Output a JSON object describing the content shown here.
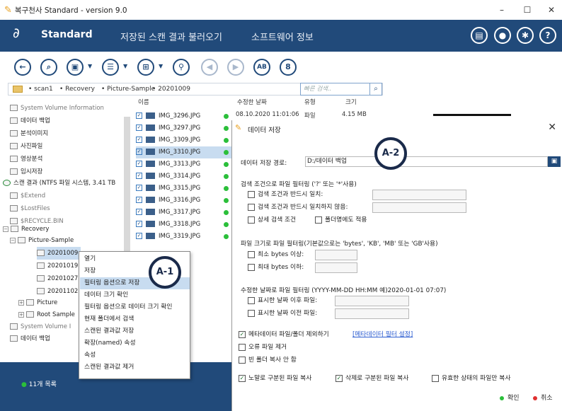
{
  "window": {
    "title": "복구천사 Standard - version 9.0",
    "controls": {
      "minimize": "–",
      "maximize": "☐",
      "close": "✕"
    }
  },
  "header": {
    "brand_name": "Standard",
    "nav": [
      "저장된 스캔 결과 불러오기",
      "소프트웨어 정보"
    ],
    "icons": [
      "card-icon",
      "user-icon",
      "gear-icon",
      "help-icon"
    ],
    "help_glyph": "?",
    "bg_color": "#214a7a"
  },
  "toolbar": {
    "buttons": [
      {
        "name": "back-icon",
        "glyph": "←",
        "disabled": false
      },
      {
        "name": "search-icon",
        "glyph": "⌕",
        "disabled": false
      },
      {
        "name": "save-icon",
        "glyph": "▣",
        "disabled": false
      },
      {
        "name": "list-view-icon",
        "glyph": "☰",
        "disabled": false
      },
      {
        "name": "grid-view-icon",
        "glyph": "⊞",
        "disabled": false
      },
      {
        "name": "binoculars-icon",
        "glyph": "⚲",
        "disabled": false
      },
      {
        "name": "prev-icon",
        "glyph": "◀",
        "disabled": true
      },
      {
        "name": "next-icon",
        "glyph": "▶",
        "disabled": true
      },
      {
        "name": "ab-compare-icon",
        "glyph": "AB",
        "disabled": false
      },
      {
        "name": "lifebuoy-icon",
        "glyph": "8",
        "disabled": false
      }
    ]
  },
  "breadcrumb": {
    "items": [
      "scan1",
      "Recovery",
      "Picture-Sample",
      "20201009"
    ],
    "search_placeholder": "빠른 검색..",
    "search_icon": "search-icon"
  },
  "tree": {
    "items": [
      {
        "label": "System Volume Information",
        "gray": true
      },
      {
        "label": "데이터 백업",
        "gray": false
      },
      {
        "label": "분석이미지",
        "gray": false
      },
      {
        "label": "사진파일",
        "gray": false
      },
      {
        "label": "영상분석",
        "gray": false
      },
      {
        "label": "임시저장",
        "gray": false
      },
      {
        "label": "스캔 결과 (NTFS 파일 시스템, 3.41 TB",
        "gray": false
      },
      {
        "label": "$Extend",
        "gray": true
      },
      {
        "label": "$LostFiles",
        "gray": true
      },
      {
        "label": "$RECYCLE.BIN",
        "gray": true
      },
      {
        "label": "Recovery",
        "gray": false
      },
      {
        "label": "Picture-Sample",
        "gray": false
      },
      {
        "label": "20201009",
        "gray": false
      },
      {
        "label": "20201019",
        "gray": false
      },
      {
        "label": "20201027",
        "gray": false
      },
      {
        "label": "20201102",
        "gray": false
      },
      {
        "label": "Picture",
        "gray": false
      },
      {
        "label": "Root Sample",
        "gray": false
      },
      {
        "label": "System Volume I",
        "gray": true
      },
      {
        "label": "데이터 백업",
        "gray": false
      }
    ],
    "expand_glyphs": {
      "collapsed": "+",
      "expanded": "−"
    }
  },
  "filelist": {
    "headers": {
      "name": "이름",
      "modified": "수정한 날짜",
      "type": "유형",
      "size": "크기"
    },
    "first_row": {
      "modified": "08.10.2020 11:01:06",
      "type": "파일",
      "size": "4.15 MB"
    },
    "check_glyph": "✓",
    "files": [
      "IMG_3296.JPG",
      "IMG_3297.JPG",
      "IMG_3309.JPG",
      "IMG_3310.JPG",
      "IMG_3313.JPG",
      "IMG_3314.JPG",
      "IMG_3315.JPG",
      "IMG_3316.JPG",
      "IMG_3317.JPG",
      "IMG_3318.JPG",
      "IMG_3319.JPG"
    ]
  },
  "context_menu": {
    "items": [
      "열기",
      "저장",
      "필터링 옵션으로 저장",
      "데이터 크기 확인",
      "필터링 옵션으로 데이터 크기 확인",
      "현재 폴더에서 검색",
      "스캔된 결과값 저장",
      "확장(named) 속성",
      "속성",
      "스캔된 결과값 제거"
    ],
    "highlighted_index": 2
  },
  "badges": {
    "a1": "A-1",
    "a2": "A-2"
  },
  "status": {
    "count_text": "11개 목록"
  },
  "dialog": {
    "title": "데이터 저장",
    "close_glyph": "✕",
    "path_label": "데이터 저장 경로:",
    "path_value": "D:/데이터 백업",
    "save_glyph": "▣",
    "section1_title": "검색 조건으로 파일 필터링 ('?' 또는 '*'사용)",
    "opt_match": "검색 조건과 반드시 일치:",
    "opt_nomatch": "검색 조건과 반드시 일치하지 않음:",
    "opt_detail": "상세 검색 조건",
    "opt_folder": "폴더명에도 적용",
    "section2_title": "파일 크기로 파일 필터링(기본값으로는 'bytes', 'KB', 'MB' 또는 'GB'사용)",
    "opt_min": "최소 bytes 이상:",
    "opt_max": "최대 bytes 이하:",
    "section3_title": "수정한 날짜로 파일 필터링 (YYYY-MM-DD HH:MM 예)2020-01-01 07:07)",
    "opt_after": "표시한 날짜 이후 파일:",
    "opt_before": "표시한 날짜 이전 파일:",
    "check_glyph": "✓",
    "meta_exclude": "메타데이터 파일/폴더 제외하기",
    "meta_link": "[메타데이터 필터 설정]",
    "error_exclude": "오류 파일 제거",
    "empty_folder": "빈 폴더 복사 안 함",
    "copy_exposed": "노말로 구분된 파일 복사",
    "copy_deleted": "삭제로 구분된 파일 복사",
    "copy_valid": "유효한 상태의 파일만 복사",
    "ok": "확인",
    "cancel": "취소",
    "ok_color": "#2bbf3a",
    "cancel_color": "#e03030"
  }
}
